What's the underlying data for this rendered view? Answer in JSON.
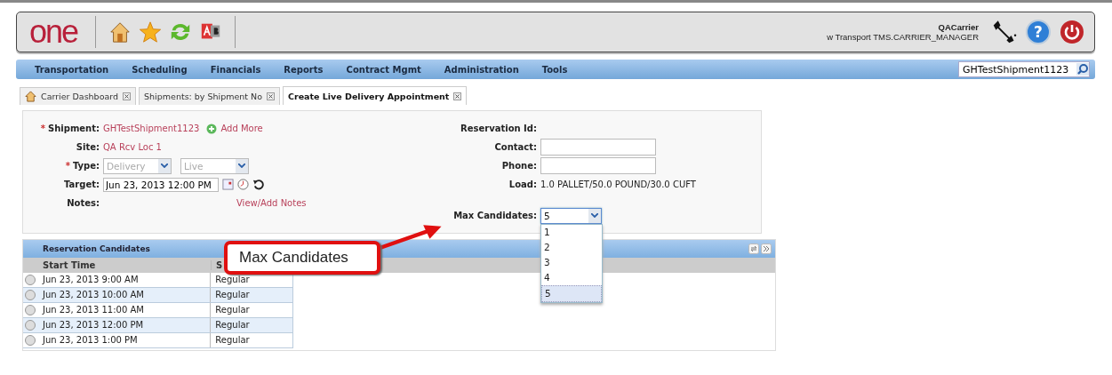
{
  "header": {
    "logo": "one",
    "help": "?",
    "user_name": "QACarrier",
    "user_role": "w Transport TMS.CARRIER_MANAGER"
  },
  "nav": {
    "items": [
      "Transportation",
      "Scheduling",
      "Financials",
      "Reports",
      "Contract Mgmt",
      "Administration",
      "Tools"
    ],
    "search": {
      "value": "GHTestShipment1123"
    }
  },
  "tabs": [
    {
      "label": "Carrier Dashboard",
      "kind": "home",
      "selected": false
    },
    {
      "label": "Shipments: by Shipment No",
      "kind": "plain",
      "selected": false
    },
    {
      "label": "Create Live Delivery Appointment",
      "kind": "plain",
      "selected": true
    }
  ],
  "form": {
    "left": [
      {
        "label": "Shipment:",
        "required": true,
        "kind": "link",
        "value": "GHTestShipment1123",
        "extra": "Add More"
      },
      {
        "label": "Site:",
        "required": false,
        "kind": "text",
        "value": "QA Rcv Loc 1"
      },
      {
        "label": "Type:",
        "required": true,
        "kind": "selects",
        "values": [
          "Delivery",
          "Live"
        ]
      },
      {
        "label": "Target:",
        "required": false,
        "kind": "datetime",
        "value": "Jun 23, 2013 12:00 PM"
      },
      {
        "label": "Notes:",
        "required": false,
        "kind": "notes",
        "value": "View/Add Notes"
      }
    ],
    "required_mark": "*",
    "right": [
      {
        "label": "Reservation Id:",
        "kind": "text"
      },
      {
        "label": "Contact:",
        "kind": "input"
      },
      {
        "label": "Phone:",
        "kind": "input"
      },
      {
        "label": "Load:",
        "kind": "text",
        "value": "1.0 PALLET/50.0 POUND/30.0 CUFT"
      }
    ],
    "max_candidates": {
      "label": "Max Candidates:",
      "value": "5",
      "expanded": true,
      "options": [
        {
          "label": "1",
          "selected": false
        },
        {
          "label": "2",
          "selected": false
        },
        {
          "label": "3",
          "selected": false
        },
        {
          "label": "4",
          "selected": false
        },
        {
          "label": "5",
          "selected": true
        }
      ]
    }
  },
  "grid": {
    "title": "Reservation Candidates",
    "columns": [
      "Start Time",
      "S"
    ],
    "rows": [
      {
        "start": "Jun 23, 2013 9:00 AM",
        "type": "Regular",
        "selected": false
      },
      {
        "start": "Jun 23, 2013 10:00 AM",
        "type": "Regular",
        "selected": false
      },
      {
        "start": "Jun 23, 2013 11:00 AM",
        "type": "Regular",
        "selected": false
      },
      {
        "start": "Jun 23, 2013 12:00 PM",
        "type": "Regular",
        "selected": false
      },
      {
        "start": "Jun 23, 2013 1:00 PM",
        "type": "Regular",
        "selected": false
      }
    ]
  },
  "callout": {
    "text": "Max Candidates"
  }
}
